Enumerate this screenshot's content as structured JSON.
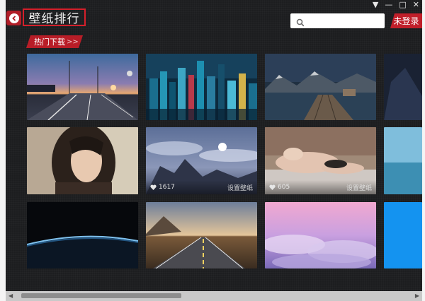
{
  "header": {
    "title": "壁纸排行",
    "login_label": "未登录",
    "search_placeholder": "",
    "window_controls": [
      "▼",
      "—",
      "□",
      "✕"
    ]
  },
  "section": {
    "hot_label": "热门下载",
    "hot_arrow": ">>"
  },
  "tiles": {
    "t5": {
      "likes": "1617",
      "action": "设置壁纸"
    },
    "t6": {
      "likes": "605",
      "action": "设置壁纸"
    }
  },
  "colors": {
    "accent_red": "#c01f2a",
    "background": "#1c1d1f"
  }
}
